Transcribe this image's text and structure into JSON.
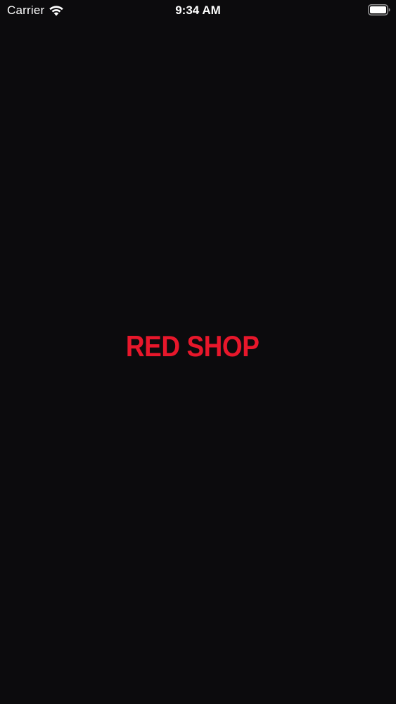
{
  "status_bar": {
    "carrier": "Carrier",
    "time": "9:34 AM",
    "wifi_icon": "wifi-icon",
    "battery_icon": "battery-full-icon"
  },
  "splash": {
    "logo_text": "RED SHOP",
    "logo_color": "#e8172b",
    "background_color": "#0c0b0d"
  }
}
